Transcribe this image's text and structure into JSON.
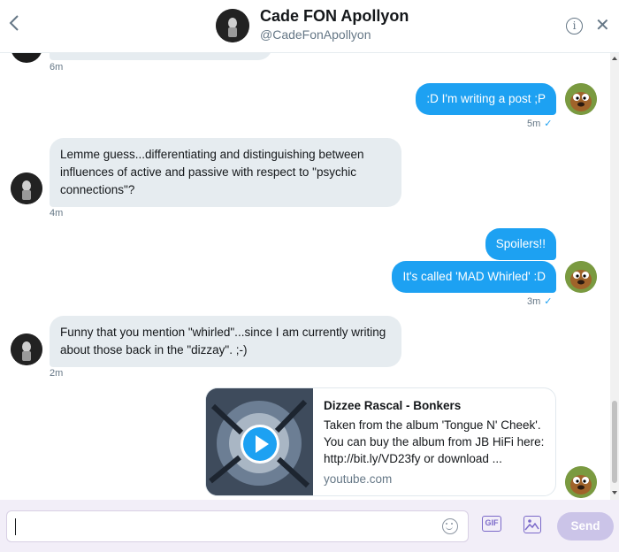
{
  "header": {
    "back_icon": "chevron-left-icon",
    "name": "Cade FON Apollyon",
    "handle": "@CadeFonApollyon",
    "info_icon_glyph": "i",
    "close_glyph": "✕"
  },
  "messages": [
    {
      "id": "m0",
      "direction": "in",
      "text": "",
      "time": "6m"
    },
    {
      "id": "m1",
      "direction": "out",
      "text": ":D I'm writing a post ;P",
      "time": "5m",
      "read": "✓"
    },
    {
      "id": "m2",
      "direction": "in",
      "text": "Lemme guess...differentiating and distinguishing between influences of active and passive with respect to \"psychic connections\"?",
      "time": "4m"
    },
    {
      "id": "m3",
      "direction": "out",
      "text": "Spoilers!!"
    },
    {
      "id": "m4",
      "direction": "out",
      "text": "It's called 'MAD Whirled' :D",
      "time": "3m",
      "read": "✓"
    },
    {
      "id": "m5",
      "direction": "in",
      "text": "Funny that you mention \"whirled\"...since I am currently writing about those back in the \"dizzay\". ;-)",
      "time": "2m"
    }
  ],
  "link_card": {
    "title": "Dizzee Rascal - Bonkers",
    "description": "Taken from the album 'Tongue N' Cheek'. You can buy the album from JB HiFi here: http://bit.ly/VD23fy or download ...",
    "domain": "youtube.com",
    "thumbnail_icon": "play-button-icon"
  },
  "composer": {
    "placeholder": "",
    "gif_label": "GIF",
    "send_label": "Send"
  },
  "colors": {
    "accent": "#1da1f2",
    "incoming_bubble": "#e6ecf0",
    "composer_bg": "#f2eef8",
    "send_disabled": "#cbc4e8"
  }
}
